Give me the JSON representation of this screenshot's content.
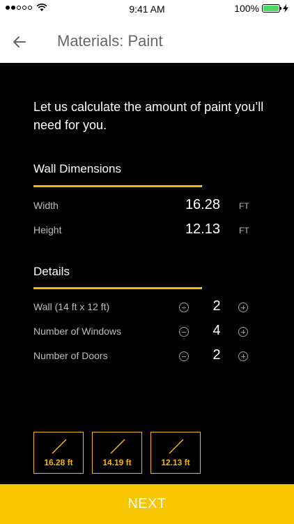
{
  "status_bar": {
    "time": "9:41 AM",
    "battery": "100%",
    "signal_bars_filled": 2,
    "signal_bars_total": 5
  },
  "nav": {
    "title": "Materials: Paint",
    "back_icon": "back-arrow-icon"
  },
  "intro_text": "Let us calculate the amount of paint you’ll need for you.",
  "wall_dimensions": {
    "title": "Wall Dimensions",
    "rows": [
      {
        "label": "Width",
        "value": "16.28",
        "unit": "FT"
      },
      {
        "label": "Height",
        "value": "12.13",
        "unit": "FT"
      }
    ]
  },
  "details": {
    "title": "Details",
    "rows": [
      {
        "label": "Wall (14 ft x 12 ft)",
        "value": "2"
      },
      {
        "label": "Number of Windows",
        "value": "4"
      },
      {
        "label": "Number of Doors",
        "value": "2"
      }
    ]
  },
  "tiles": [
    {
      "label": "16.28 ft",
      "icon": "diagonal-line-icon"
    },
    {
      "label": "14.19 ft",
      "icon": "diagonal-line-icon"
    },
    {
      "label": "12.13 ft",
      "icon": "diagonal-line-icon"
    }
  ],
  "next_button": "NEXT",
  "colors": {
    "accent": "#f5b800",
    "button": "#f8c600",
    "background": "#000000"
  }
}
